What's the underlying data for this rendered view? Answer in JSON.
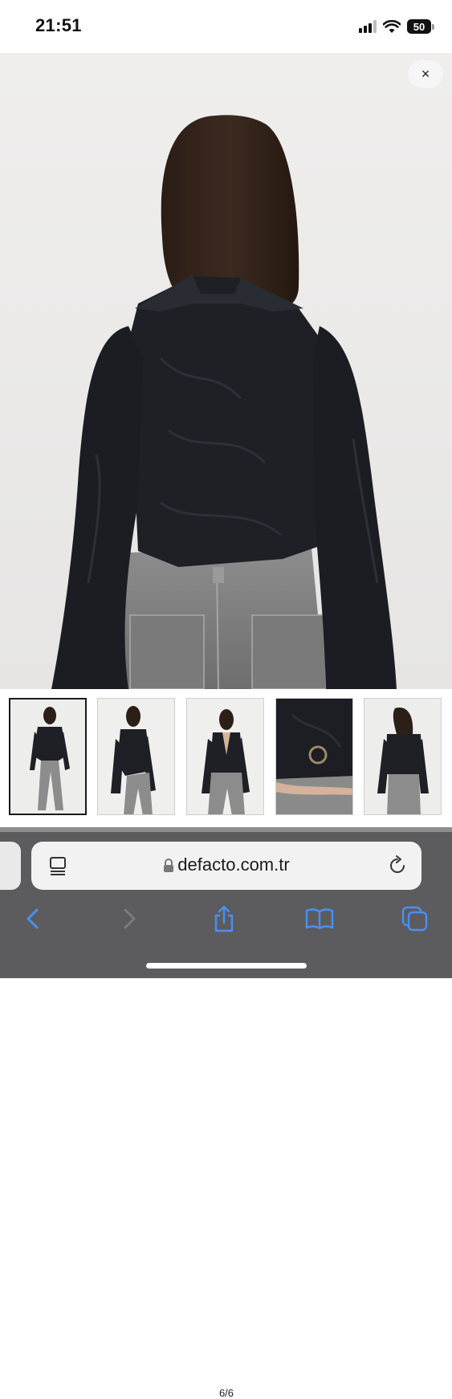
{
  "status_bar": {
    "time": "21:51",
    "battery_percent": "50",
    "signal_bars_filled": 3,
    "signal_bars_total": 4
  },
  "viewer": {
    "close_icon": "close-icon",
    "close_glyph": "×",
    "counter": "6/6",
    "active_thumbnail_index": 0,
    "thumbnails": [
      {
        "name": "thumb-front-full"
      },
      {
        "name": "thumb-side-pose"
      },
      {
        "name": "thumb-front-open"
      },
      {
        "name": "thumb-detail-buckle"
      },
      {
        "name": "thumb-back-view"
      }
    ]
  },
  "browser": {
    "url": "defacto.com.tr",
    "icons": {
      "tabs_overview": "page-menu-icon",
      "lock": "lock-icon",
      "reload": "reload-icon",
      "back": "chevron-left-icon",
      "forward": "chevron-right-icon",
      "share": "share-icon",
      "bookmarks": "book-icon",
      "tabs": "tabs-icon"
    },
    "accent_color": "#4a90f0"
  }
}
